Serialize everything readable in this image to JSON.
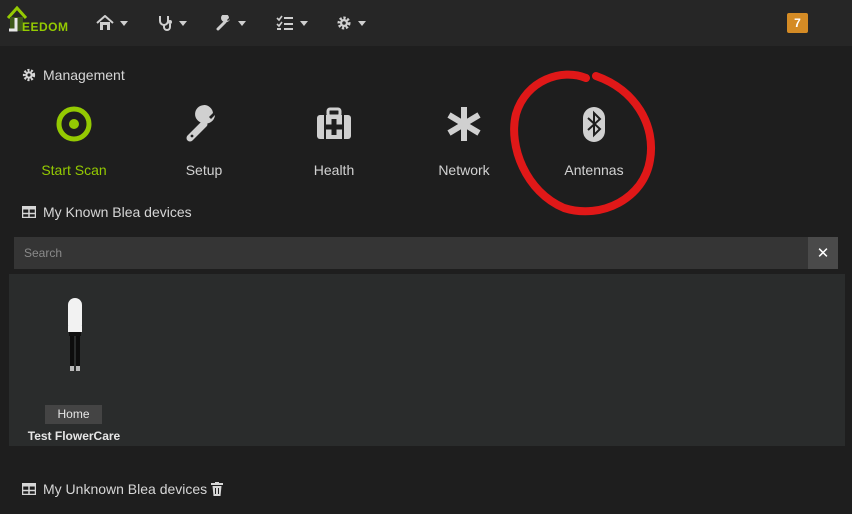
{
  "navbar": {
    "logo_text": "EEDOM",
    "menus": [
      {
        "name": "home",
        "icon": "home-icon"
      },
      {
        "name": "analysis",
        "icon": "stethoscope-icon"
      },
      {
        "name": "tools",
        "icon": "wrench-icon"
      },
      {
        "name": "plugins",
        "icon": "tasks-icon"
      },
      {
        "name": "settings",
        "icon": "gear-icon"
      }
    ],
    "notification_count": "7",
    "notification_color": "#d48b25"
  },
  "management": {
    "title": "Management",
    "icon": "gear-icon",
    "tiles": [
      {
        "label": "Start Scan",
        "icon": "target-icon",
        "active": true
      },
      {
        "label": "Setup",
        "icon": "wrench-icon"
      },
      {
        "label": "Health",
        "icon": "medkit-icon"
      },
      {
        "label": "Network",
        "icon": "asterisk-icon"
      },
      {
        "label": "Antennas",
        "icon": "bluetooth-icon",
        "annotated": true
      }
    ]
  },
  "known_devices": {
    "title": "My Known Blea devices",
    "icon": "table-icon",
    "search": {
      "placeholder": "Search",
      "value": ""
    },
    "devices": [
      {
        "object": "Home",
        "name": "Test FlowerCare"
      }
    ]
  },
  "unknown_devices": {
    "title": "My Unknown Blea devices",
    "icon": "table-icon",
    "action_icon": "trash-icon"
  },
  "colors": {
    "accent": "#94ca02",
    "annotation": "#e01818",
    "background": "#1e1e1e",
    "navbar": "#262626"
  }
}
